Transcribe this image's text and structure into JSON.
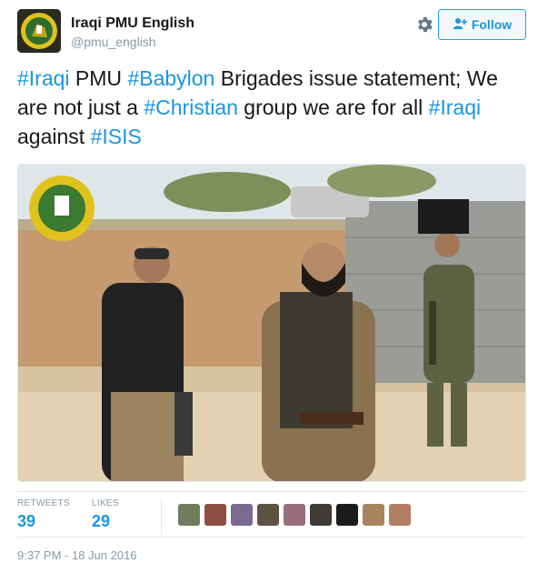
{
  "account": {
    "name": "Iraqi PMU English",
    "handle": "@pmu_english"
  },
  "actions": {
    "follow_label": "Follow"
  },
  "tweet": {
    "segments": [
      {
        "text": "#Iraqi",
        "hashtag": true
      },
      {
        "text": " PMU ",
        "hashtag": false
      },
      {
        "text": "#Babylon",
        "hashtag": true
      },
      {
        "text": " Brigades issue statement; We are not just a ",
        "hashtag": false
      },
      {
        "text": "#Christian",
        "hashtag": true
      },
      {
        "text": " group we are for all ",
        "hashtag": false
      },
      {
        "text": "#Iraqi",
        "hashtag": true
      },
      {
        "text": " against ",
        "hashtag": false
      },
      {
        "text": "#ISIS",
        "hashtag": true
      }
    ]
  },
  "stats": {
    "retweets_label": "RETWEETS",
    "retweets_count": "39",
    "likes_label": "LIKES",
    "likes_count": "29"
  },
  "timestamp": "9:37 PM - 18 Jun 2016",
  "colors": {
    "link": "#1b95e0",
    "muted": "#8899a6",
    "border": "#e1e8ed"
  }
}
